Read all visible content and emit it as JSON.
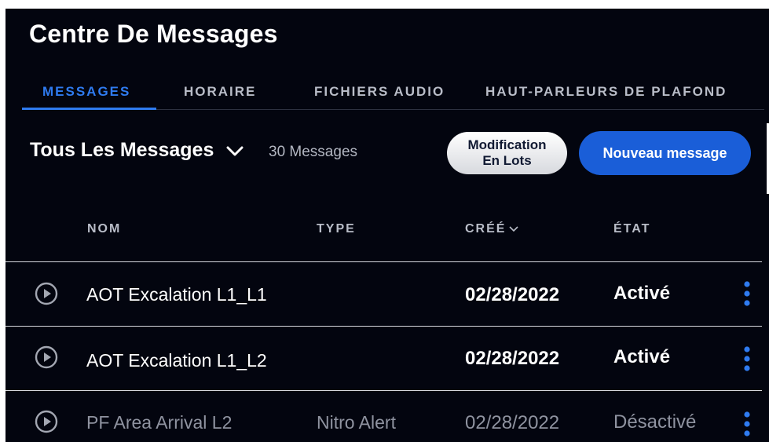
{
  "header": {
    "title": "Centre De Messages"
  },
  "tabs": [
    {
      "label": "MESSAGES",
      "active": true
    },
    {
      "label": "HORAIRE",
      "active": false
    },
    {
      "label": "FICHIERS AUDIO",
      "active": false
    },
    {
      "label": "HAUT-PARLEURS DE PLAFOND",
      "active": false
    }
  ],
  "toolbar": {
    "filter_label": "Tous Les Messages",
    "count_label": "30 Messages",
    "bulk_edit_label": "Modification\nEn Lots",
    "new_message_label": "Nouveau message"
  },
  "table": {
    "columns": {
      "name": "NOM",
      "type": "TYPE",
      "created": "CRÉÉ",
      "status": "ÉTAT"
    },
    "sort_column": "created",
    "rows": [
      {
        "name": "AOT Excalation L1_L1",
        "type": "",
        "created": "02/28/2022",
        "status": "Activé",
        "enabled": true
      },
      {
        "name": "AOT Excalation L1_L2",
        "type": "",
        "created": "02/28/2022",
        "status": "Activé",
        "enabled": true
      },
      {
        "name": "PF Area Arrival L2",
        "type": "Nitro Alert",
        "created": "02/28/2022",
        "status": "Désactivé",
        "enabled": false
      }
    ]
  },
  "icons": {
    "filter": "chevron-down-icon",
    "sort": "sort-down-icon",
    "row_play": "play-circle-icon",
    "row_menu": "kebab-menu-icon"
  },
  "colors": {
    "background": "#03050f",
    "accent": "#2f7bf0",
    "primary_button": "#1a5ed8",
    "muted_text": "#8f93a0"
  }
}
